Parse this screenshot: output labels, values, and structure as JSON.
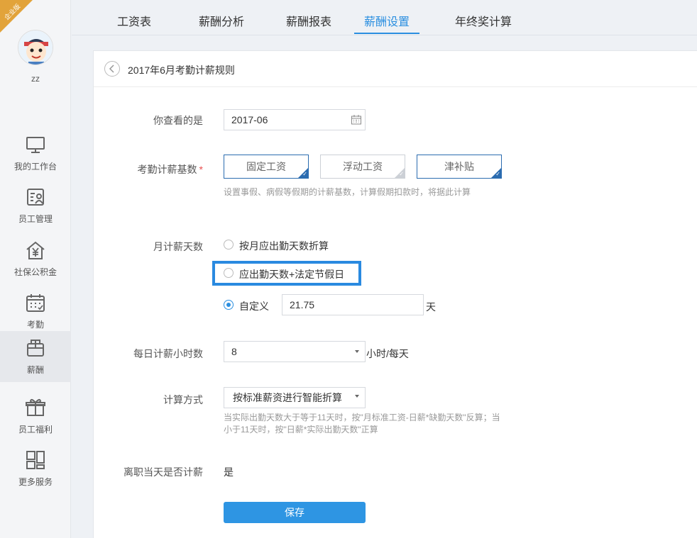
{
  "sidebar": {
    "badge": "企业版",
    "user_name": "zz",
    "items": [
      {
        "label": "我的工作台",
        "icon": "monitor-icon"
      },
      {
        "label": "员工管理",
        "icon": "employee-card-icon"
      },
      {
        "label": "社保公积金",
        "icon": "house-yen-icon"
      },
      {
        "label": "考勤",
        "icon": "calendar-icon"
      },
      {
        "label": "薪酬",
        "icon": "wallet-icon"
      },
      {
        "label": "员工福利",
        "icon": "gift-icon"
      },
      {
        "label": "更多服务",
        "icon": "grid-icon"
      }
    ],
    "active_index": 4
  },
  "tabs": [
    {
      "label": "工资表"
    },
    {
      "label": "薪酬分析"
    },
    {
      "label": "薪酬报表"
    },
    {
      "label": "薪酬设置"
    },
    {
      "label": "年终奖计算"
    }
  ],
  "active_tab": 3,
  "page": {
    "title": "2017年6月考勤计薪规则"
  },
  "form": {
    "view_label": "你查看的是",
    "view_value": "2017-06",
    "base_label": "考勤计薪基数",
    "base_required": "*",
    "base_options": [
      {
        "label": "固定工资",
        "selected": true
      },
      {
        "label": "浮动工资",
        "selected": false
      },
      {
        "label": "津补贴",
        "selected": true
      }
    ],
    "base_hint": "设置事假、病假等假期的计薪基数，计算假期扣款时，将据此计算",
    "days_label": "月计薪天数",
    "days_options": [
      {
        "label": "按月应出勤天数折算",
        "checked": false
      },
      {
        "label": "应出勤天数+法定节假日",
        "checked": false
      },
      {
        "label": "自定义",
        "checked": true
      }
    ],
    "custom_days_value": "21.75",
    "custom_days_unit": "天",
    "hours_label": "每日计薪小时数",
    "hours_value": "8",
    "hours_unit": "小时/每天",
    "method_label": "计算方式",
    "method_value": "按标准薪资进行智能折算",
    "method_hint_line1": "当实际出勤天数大于等于11天时，按\"月标准工资-日薪*缺勤天数\"反算；当",
    "method_hint_line2": "小于11天时，按\"日薪*实际出勤天数\"正算",
    "leave_label": "离职当天是否计薪",
    "leave_value": "是",
    "save_label": "保存"
  },
  "colors": {
    "accent": "#2b8fe0",
    "selected_border": "#2b6cb0",
    "highlight_border": "#2a8ae0",
    "save_button": "#2e95e3",
    "badge": "#e2a33a"
  }
}
